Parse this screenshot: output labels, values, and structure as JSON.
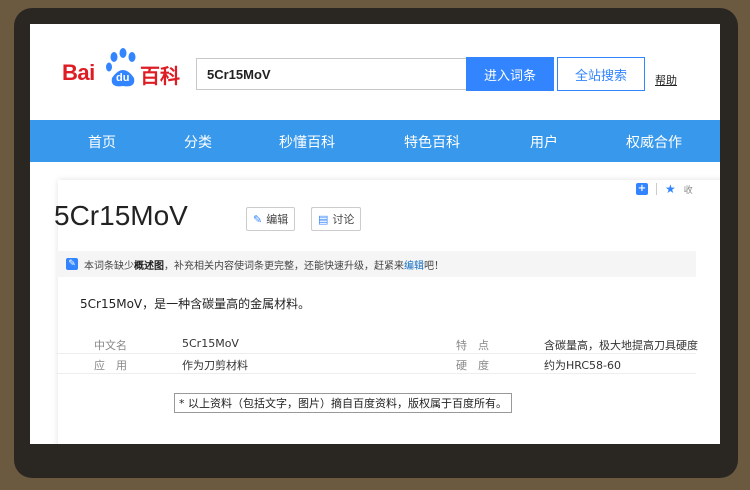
{
  "header": {
    "logo": {
      "bai": "Bai",
      "du": "du",
      "baike": "百科"
    },
    "search": {
      "value": "5Cr15MoV"
    },
    "enter_button": "进入词条",
    "site_search_button": "全站搜索",
    "help_link": "帮助"
  },
  "nav": {
    "items": [
      "首页",
      "分类",
      "秒懂百科",
      "特色百科",
      "用户",
      "权威合作"
    ]
  },
  "side_tools": {
    "collect_label": "收"
  },
  "entry": {
    "title": "5Cr15MoV",
    "edit_label": "编辑",
    "discuss_label": "讨论",
    "notice": {
      "before": "本词条缺少",
      "bold": "概述图",
      "middle": "，补充相关内容使词条更完整，还能快速升级，赶紧来",
      "link": "编辑",
      "after": "吧！"
    },
    "summary": "5Cr15MoV，是一种含碳量高的金属材料。",
    "info": [
      {
        "k1": "中文名",
        "v1": "5Cr15MoV",
        "k2": "特　点",
        "v2": "含碳量高，极大地提高刀具硬度"
      },
      {
        "k1": "应　用",
        "v1": "作为刀剪材料",
        "k2": "硬　度",
        "v2": "约为HRC58-60"
      }
    ]
  },
  "caption": "* 以上资料（包括文字，图片）摘自百度资料，版权属于百度所有。",
  "colors": {
    "brand_red": "#de1c24",
    "brand_blue": "#3385ff",
    "nav_blue": "#3899ec",
    "frame_brown": "#6b5a40"
  },
  "icons": [
    "paw-icon",
    "pencil-icon",
    "discuss-icon",
    "plus-icon",
    "star-icon"
  ]
}
